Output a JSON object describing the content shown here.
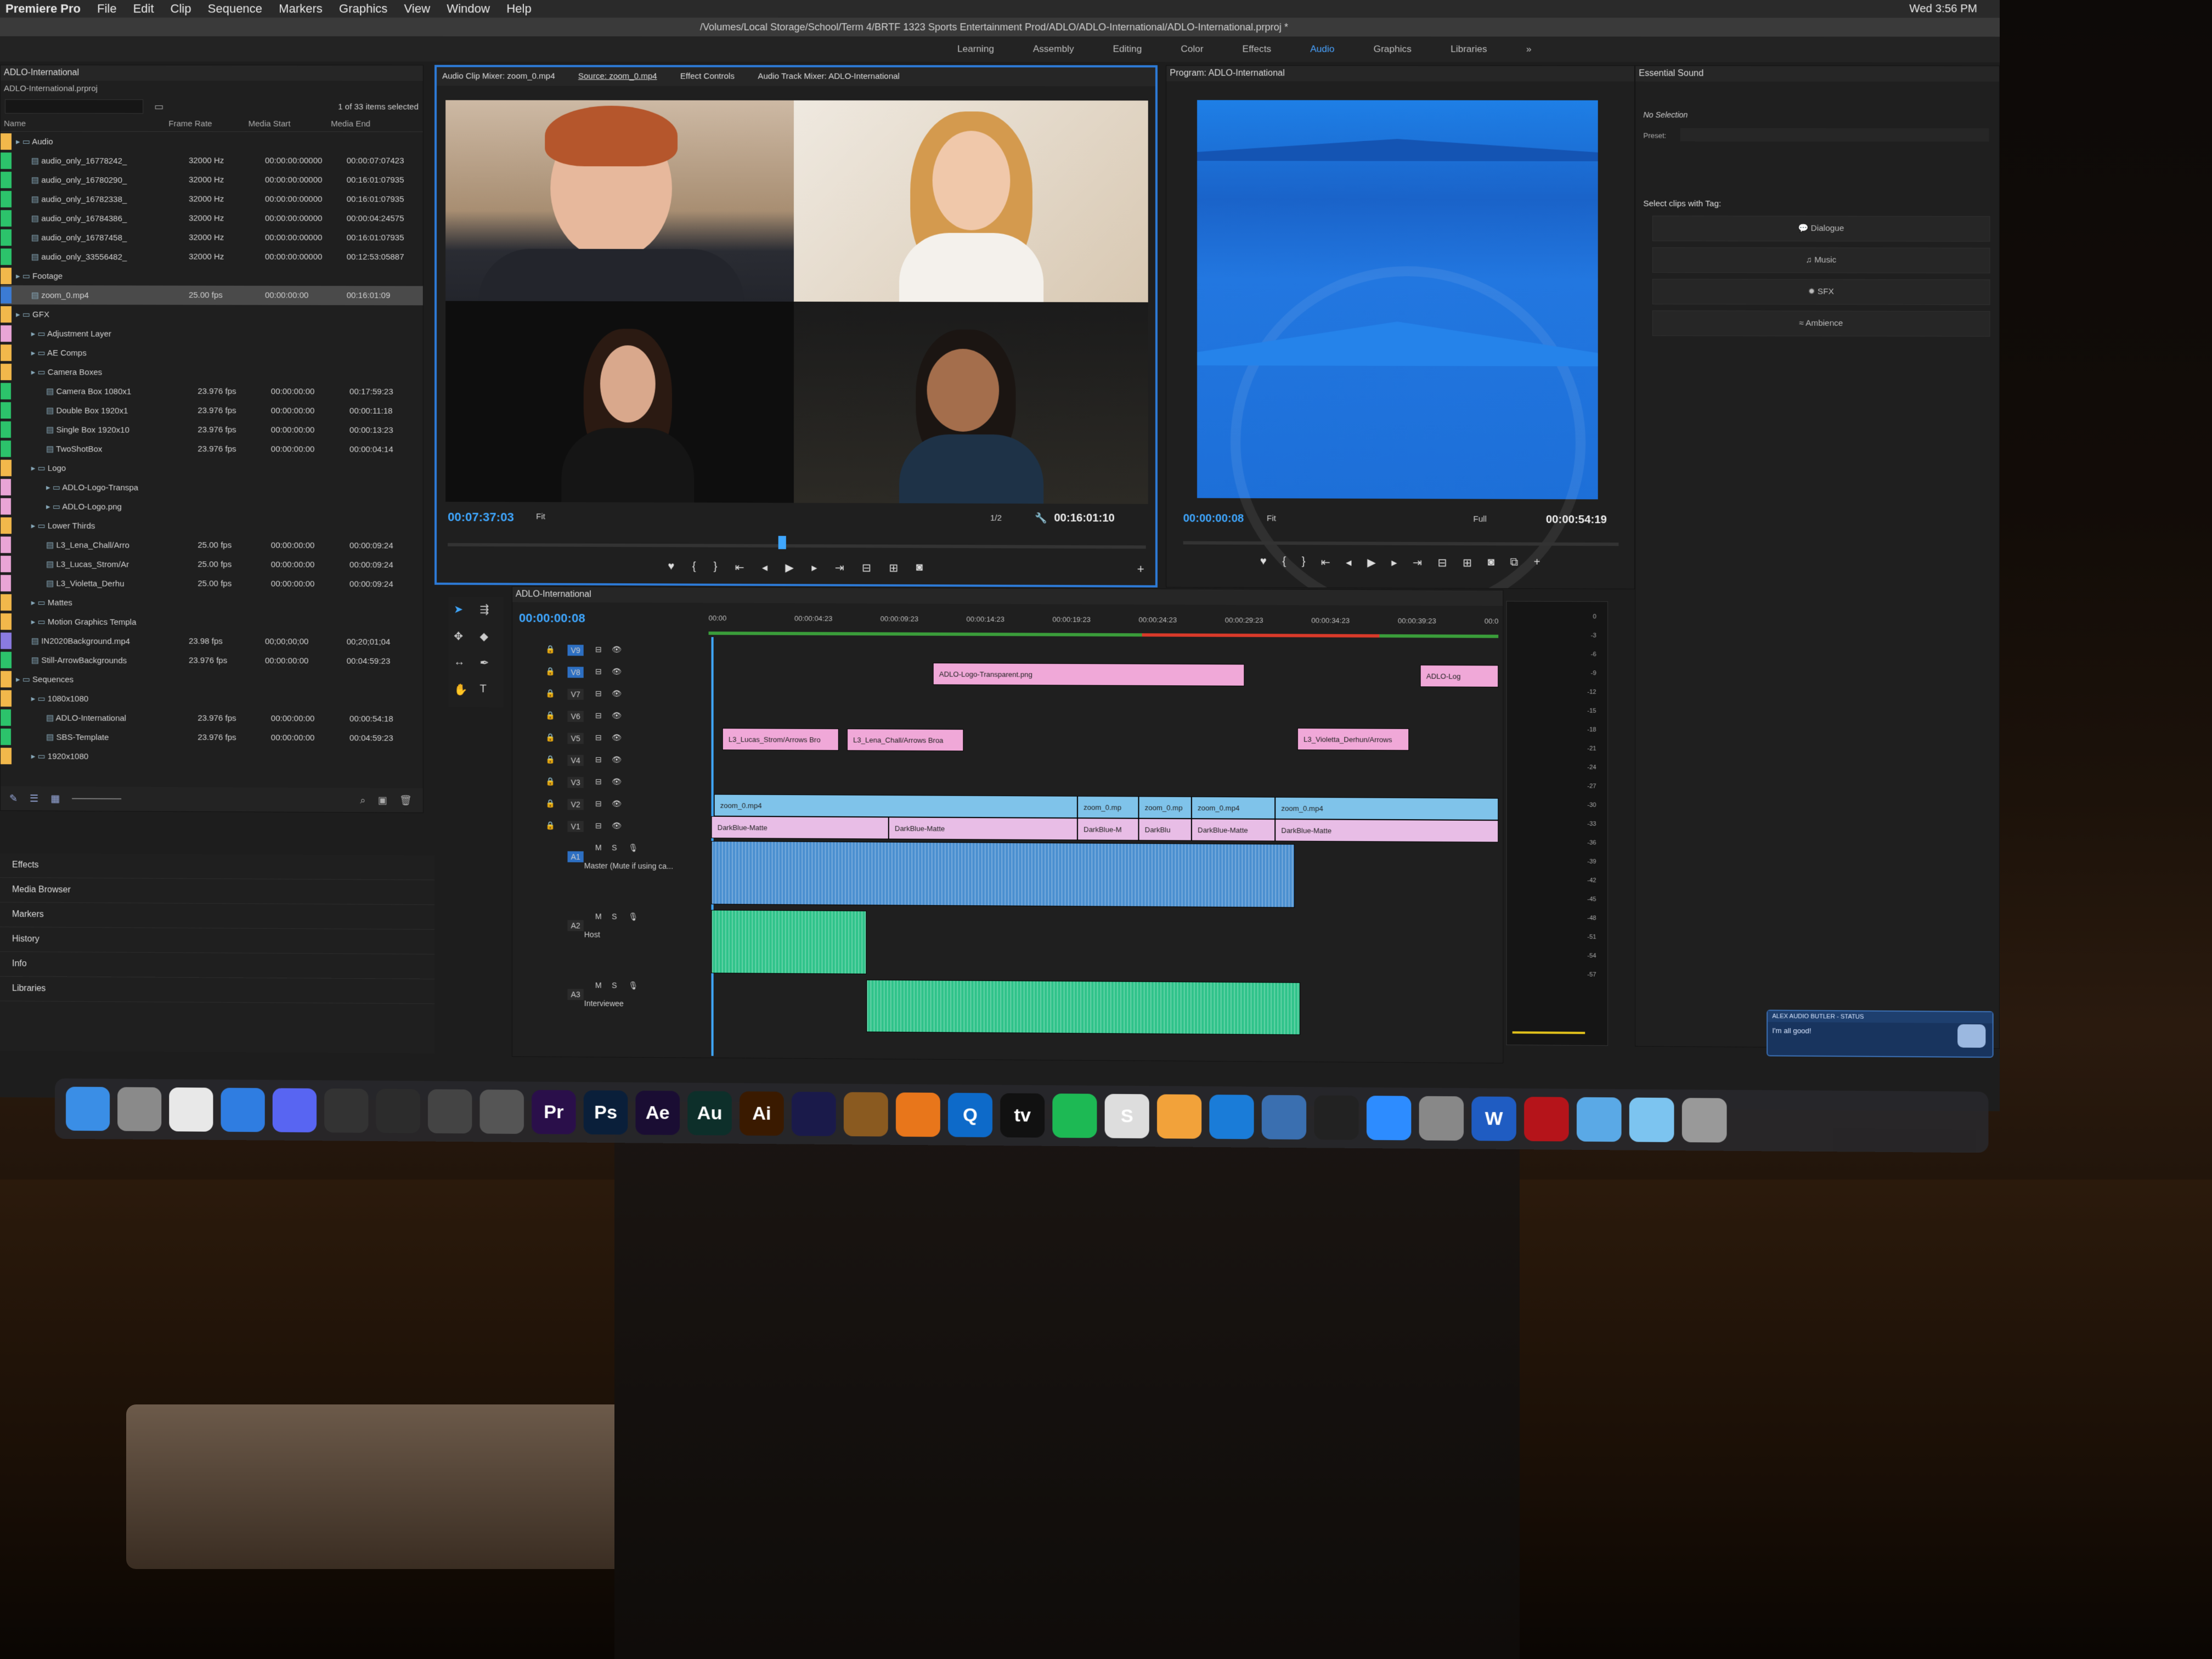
{
  "menubar": {
    "app": "Premiere Pro",
    "items": [
      "File",
      "Edit",
      "Clip",
      "Sequence",
      "Markers",
      "Graphics",
      "View",
      "Window",
      "Help"
    ],
    "clock": "Wed 3:56 PM"
  },
  "title_path": "/Volumes/Local Storage/School/Term 4/BRTF 1323 Sports Entertainment Prod/ADLO/ADLO-International/ADLO-International.prproj *",
  "workspaces": [
    "Learning",
    "Assembly",
    "Editing",
    "Color",
    "Effects",
    "Audio",
    "Graphics",
    "Libraries"
  ],
  "workspace_active": "Audio",
  "project": {
    "title": "ADLO-International",
    "file": "ADLO-International.prproj",
    "selected_count": "1 of 33 items selected",
    "headers": [
      "Name",
      "Frame Rate",
      "Media Start",
      "Media End"
    ],
    "rows": [
      {
        "name": "Audio",
        "rate": "",
        "start": "",
        "end": "",
        "color": "#f2b84b",
        "indent": 0
      },
      {
        "name": "audio_only_16778242_",
        "rate": "32000 Hz",
        "start": "00:00:00:00000",
        "end": "00:00:07:07423",
        "color": "#2cc36b",
        "indent": 1
      },
      {
        "name": "audio_only_16780290_",
        "rate": "32000 Hz",
        "start": "00:00:00:00000",
        "end": "00:16:01:07935",
        "color": "#2cc36b",
        "indent": 1
      },
      {
        "name": "audio_only_16782338_",
        "rate": "32000 Hz",
        "start": "00:00:00:00000",
        "end": "00:16:01:07935",
        "color": "#2cc36b",
        "indent": 1
      },
      {
        "name": "audio_only_16784386_",
        "rate": "32000 Hz",
        "start": "00:00:00:00000",
        "end": "00:00:04:24575",
        "color": "#2cc36b",
        "indent": 1
      },
      {
        "name": "audio_only_16787458_",
        "rate": "32000 Hz",
        "start": "00:00:00:00000",
        "end": "00:16:01:07935",
        "color": "#2cc36b",
        "indent": 1
      },
      {
        "name": "audio_only_33556482_",
        "rate": "32000 Hz",
        "start": "00:00:00:00000",
        "end": "00:12:53:05887",
        "color": "#2cc36b",
        "indent": 1
      },
      {
        "name": "Footage",
        "rate": "",
        "start": "",
        "end": "",
        "color": "#f2b84b",
        "indent": 0
      },
      {
        "name": "zoom_0.mp4",
        "rate": "25.00 fps",
        "start": "00:00:00:00",
        "end": "00:16:01:09",
        "color": "#3b7bd4",
        "indent": 1,
        "selected": true
      },
      {
        "name": "GFX",
        "rate": "",
        "start": "",
        "end": "",
        "color": "#f2b84b",
        "indent": 0
      },
      {
        "name": "Adjustment Layer",
        "rate": "",
        "start": "",
        "end": "",
        "color": "#e9a5d6",
        "indent": 1
      },
      {
        "name": "AE Comps",
        "rate": "",
        "start": "",
        "end": "",
        "color": "#f2b84b",
        "indent": 1
      },
      {
        "name": "Camera Boxes",
        "rate": "",
        "start": "",
        "end": "",
        "color": "#f2b84b",
        "indent": 1
      },
      {
        "name": "Camera Box 1080x1",
        "rate": "23.976 fps",
        "start": "00:00:00:00",
        "end": "00:17:59:23",
        "color": "#2cc36b",
        "indent": 2
      },
      {
        "name": "Double Box 1920x1",
        "rate": "23.976 fps",
        "start": "00:00:00:00",
        "end": "00:00:11:18",
        "color": "#2cc36b",
        "indent": 2
      },
      {
        "name": "Single Box 1920x10",
        "rate": "23.976 fps",
        "start": "00:00:00:00",
        "end": "00:00:13:23",
        "color": "#2cc36b",
        "indent": 2
      },
      {
        "name": "TwoShotBox",
        "rate": "23.976 fps",
        "start": "00:00:00:00",
        "end": "00:00:04:14",
        "color": "#2cc36b",
        "indent": 2
      },
      {
        "name": "Logo",
        "rate": "",
        "start": "",
        "end": "",
        "color": "#f2b84b",
        "indent": 1
      },
      {
        "name": "ADLO-Logo-Transpa",
        "rate": "",
        "start": "",
        "end": "",
        "color": "#e9a5d6",
        "indent": 2
      },
      {
        "name": "ADLO-Logo.png",
        "rate": "",
        "start": "",
        "end": "",
        "color": "#e9a5d6",
        "indent": 2
      },
      {
        "name": "Lower Thirds",
        "rate": "",
        "start": "",
        "end": "",
        "color": "#f2b84b",
        "indent": 1
      },
      {
        "name": "L3_Lena_Chall/Arro",
        "rate": "25.00 fps",
        "start": "00:00:00:00",
        "end": "00:00:09:24",
        "color": "#e9a5d6",
        "indent": 2
      },
      {
        "name": "L3_Lucas_Strom/Ar",
        "rate": "25.00 fps",
        "start": "00:00:00:00",
        "end": "00:00:09:24",
        "color": "#e9a5d6",
        "indent": 2
      },
      {
        "name": "L3_Violetta_Derhu",
        "rate": "25.00 fps",
        "start": "00:00:00:00",
        "end": "00:00:09:24",
        "color": "#e9a5d6",
        "indent": 2
      },
      {
        "name": "Mattes",
        "rate": "",
        "start": "",
        "end": "",
        "color": "#f2b84b",
        "indent": 1
      },
      {
        "name": "Motion Graphics Templa",
        "rate": "",
        "start": "",
        "end": "",
        "color": "#f2b84b",
        "indent": 1
      },
      {
        "name": "IN2020Background.mp4",
        "rate": "23.98 fps",
        "start": "00;00;00;00",
        "end": "00;20;01;04",
        "color": "#8a7be0",
        "indent": 1
      },
      {
        "name": "Still-ArrowBackgrounds",
        "rate": "23.976 fps",
        "start": "00:00:00:00",
        "end": "00:04:59:23",
        "color": "#2cc36b",
        "indent": 1
      },
      {
        "name": "Sequences",
        "rate": "",
        "start": "",
        "end": "",
        "color": "#f2b84b",
        "indent": 0
      },
      {
        "name": "1080x1080",
        "rate": "",
        "start": "",
        "end": "",
        "color": "#f2b84b",
        "indent": 1
      },
      {
        "name": "ADLO-International",
        "rate": "23.976 fps",
        "start": "00:00:00:00",
        "end": "00:00:54:18",
        "color": "#2cc36b",
        "indent": 2
      },
      {
        "name": "SBS-Template",
        "rate": "23.976 fps",
        "start": "00:00:00:00",
        "end": "00:04:59:23",
        "color": "#2cc36b",
        "indent": 2
      },
      {
        "name": "1920x1080",
        "rate": "",
        "start": "",
        "end": "",
        "color": "#f2b84b",
        "indent": 1
      }
    ],
    "lower_tabs": [
      "Effects",
      "Media Browser",
      "Markers",
      "History",
      "Info",
      "Libraries"
    ]
  },
  "source": {
    "tabs": [
      "Audio Clip Mixer: zoom_0.mp4",
      "Source: zoom_0.mp4",
      "Effect Controls",
      "Audio Track Mixer: ADLO-International"
    ],
    "timecode_in": "00:07:37:03",
    "fit": "Fit",
    "ratio": "1/2",
    "duration": "00:16:01:10"
  },
  "program": {
    "title": "Program: ADLO-International",
    "timecode": "00:00:00:08",
    "fit": "Fit",
    "quality": "Full",
    "duration": "00:00:54:19"
  },
  "essential": {
    "title": "Essential Sound",
    "no_selection": "No Selection",
    "preset_label": "Preset:",
    "tags_label": "Select clips with Tag:",
    "tags": [
      "Dialogue",
      "Music",
      "SFX",
      "Ambience"
    ]
  },
  "timeline": {
    "title": "ADLO-International",
    "timecode": "00:00:00:08",
    "ruler": [
      "00:00",
      "00:00:04:23",
      "00:00:09:23",
      "00:00:14:23",
      "00:00:19:23",
      "00:00:24:23",
      "00:00:29:23",
      "00:00:34:23",
      "00:00:39:23",
      "00:0"
    ],
    "video_tracks": [
      "V9",
      "V8",
      "V7",
      "V6",
      "V5",
      "V4",
      "V3",
      "V2",
      "V1"
    ],
    "audio_tracks": [
      {
        "id": "A1",
        "name": "Master (Mute if using ca..."
      },
      {
        "id": "A2",
        "name": "Host"
      },
      {
        "id": "A3",
        "name": "Interviewee"
      }
    ],
    "clips": {
      "logo": "ADLO-Logo-Transparent.png",
      "logo2": "ADLO-Log",
      "l3_lucas": "L3_Lucas_Strom/Arrows Bro",
      "l3_lena": "L3_Lena_Chall/Arrows Broa",
      "l3_violetta": "L3_Violetta_Derhun/Arrows",
      "zoom": "zoom_0.mp4",
      "zoom_short": "zoom_0.mp",
      "matte": "DarkBlue-Matte",
      "matte_short": "DarkBlue-M",
      "matte_short2": "DarkBlu"
    }
  },
  "butler": {
    "title": "ALEX AUDIO BUTLER - STATUS",
    "status": "I'm all good!"
  },
  "dock": [
    "Finder",
    "Launchpad",
    "Chrome",
    "Safari",
    "Discord",
    "Final Cut",
    "DaVinci",
    "Logic",
    "Motion",
    "Pr",
    "Ps",
    "Ae",
    "Au",
    "Ai",
    "Media Encoder",
    "Cocktail",
    "VLC",
    "Q",
    "tv",
    "Spotify",
    "S",
    "Sublime",
    "VS Code",
    "Layers",
    "Terminal",
    "Zoom",
    "Settings",
    "W",
    "Acrobat",
    "Folder",
    "Folder",
    "Trash"
  ]
}
